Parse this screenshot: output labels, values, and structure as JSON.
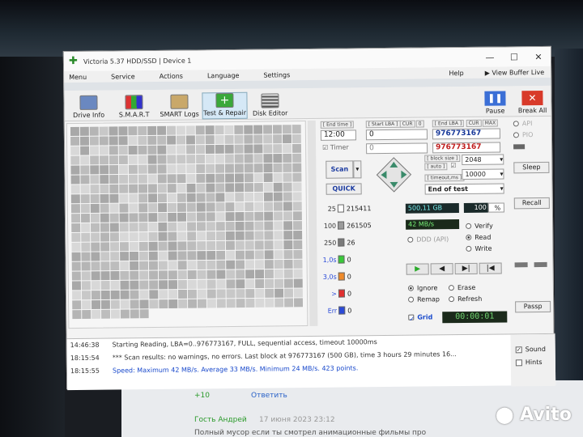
{
  "window": {
    "title": "Victoria 5.37 HDD/SSD | Device 1",
    "controls": [
      "—",
      "☐",
      "✕"
    ]
  },
  "menu": {
    "items": [
      "Menu",
      "Service",
      "Actions",
      "Language",
      "Settings"
    ],
    "help": "Help",
    "view_buffer": "▶ View Buffer Live"
  },
  "toolbar": {
    "buttons": [
      "Drive Info",
      "S.M.A.R.T",
      "SMART Logs",
      "Test & Repair",
      "Disk Editor"
    ],
    "pause": "Pause",
    "break_all": "Break All"
  },
  "scan": {
    "end_time_label": "[ End time ]",
    "end_time_value": "12:00",
    "timer_label": "Timer",
    "timer_value": "0",
    "start_lba_label": "[ Start LBA ]",
    "cur_label": "CUR",
    "start_lba_value": "0",
    "end_lba_label": "[ End LBA ]",
    "max_label": "MAX",
    "end_lba_value": "976773167",
    "end_lba_value2": "976773167",
    "block_size_label": "[ block size ]",
    "auto_label": "[ auto ]",
    "block_size_value": "2048",
    "timeout_label": "[ timeout,ms ]",
    "timeout_value": "10000",
    "scan_button": "Scan",
    "quick_button": "QUICK",
    "end_action": "End of test",
    "api_label": "API",
    "pio_label": "PIO"
  },
  "histogram": [
    {
      "label": "25",
      "count": "215411",
      "color": "#ffffff"
    },
    {
      "label": "100",
      "count": "261505",
      "color": "#9a9a9a"
    },
    {
      "label": "250",
      "count": "26",
      "color": "#7a7a7a"
    },
    {
      "label": "1,0s",
      "count": "0",
      "color": "#39c939"
    },
    {
      "label": "3,0s",
      "count": "0",
      "color": "#ef8a2a"
    },
    {
      "label": ">",
      "count": "0",
      "color": "#e03030"
    },
    {
      "label": "Err",
      "count": "0",
      "color": "#2a4ad8"
    }
  ],
  "status": {
    "size": "500,11 GB",
    "percent": "100",
    "percent_unit": "%",
    "speed": "42 MB/s",
    "ddd_label": "DDD (API)",
    "verify": "Verify",
    "read": "Read",
    "write": "Write",
    "ignore": "Ignore",
    "erase": "Erase",
    "remap": "Remap",
    "refresh": "Refresh",
    "grid_label": "Grid",
    "elapsed": "00:00:01"
  },
  "side_buttons": {
    "sleep": "Sleep",
    "recall": "Recall",
    "passp": "Passp"
  },
  "log": [
    {
      "time": "14:46:38",
      "message": "Starting Reading, LBA=0..976773167, FULL, sequential access, timeout 10000ms",
      "style": "normal"
    },
    {
      "time": "18:15:54",
      "message": "*** Scan results: no warnings, no errors. Last block at 976773167 (500 GB), time 3 hours 29 minutes 16...",
      "style": "normal"
    },
    {
      "time": "18:15:55",
      "message": "Speed: Maximum 42 MB/s. Average 33 MB/s. Minimum 24 MB/s. 423 points.",
      "style": "blue"
    }
  ],
  "log_options": {
    "sound": "Sound",
    "hints": "Hints"
  },
  "background_page": {
    "likes": "+10",
    "reply": "Ответить",
    "author": "Гость Андрей",
    "date": "17 июня 2023 23:12",
    "comment": "Полный мусор если ты смотрел анимационные фильмы про",
    "avito": "Avito"
  }
}
